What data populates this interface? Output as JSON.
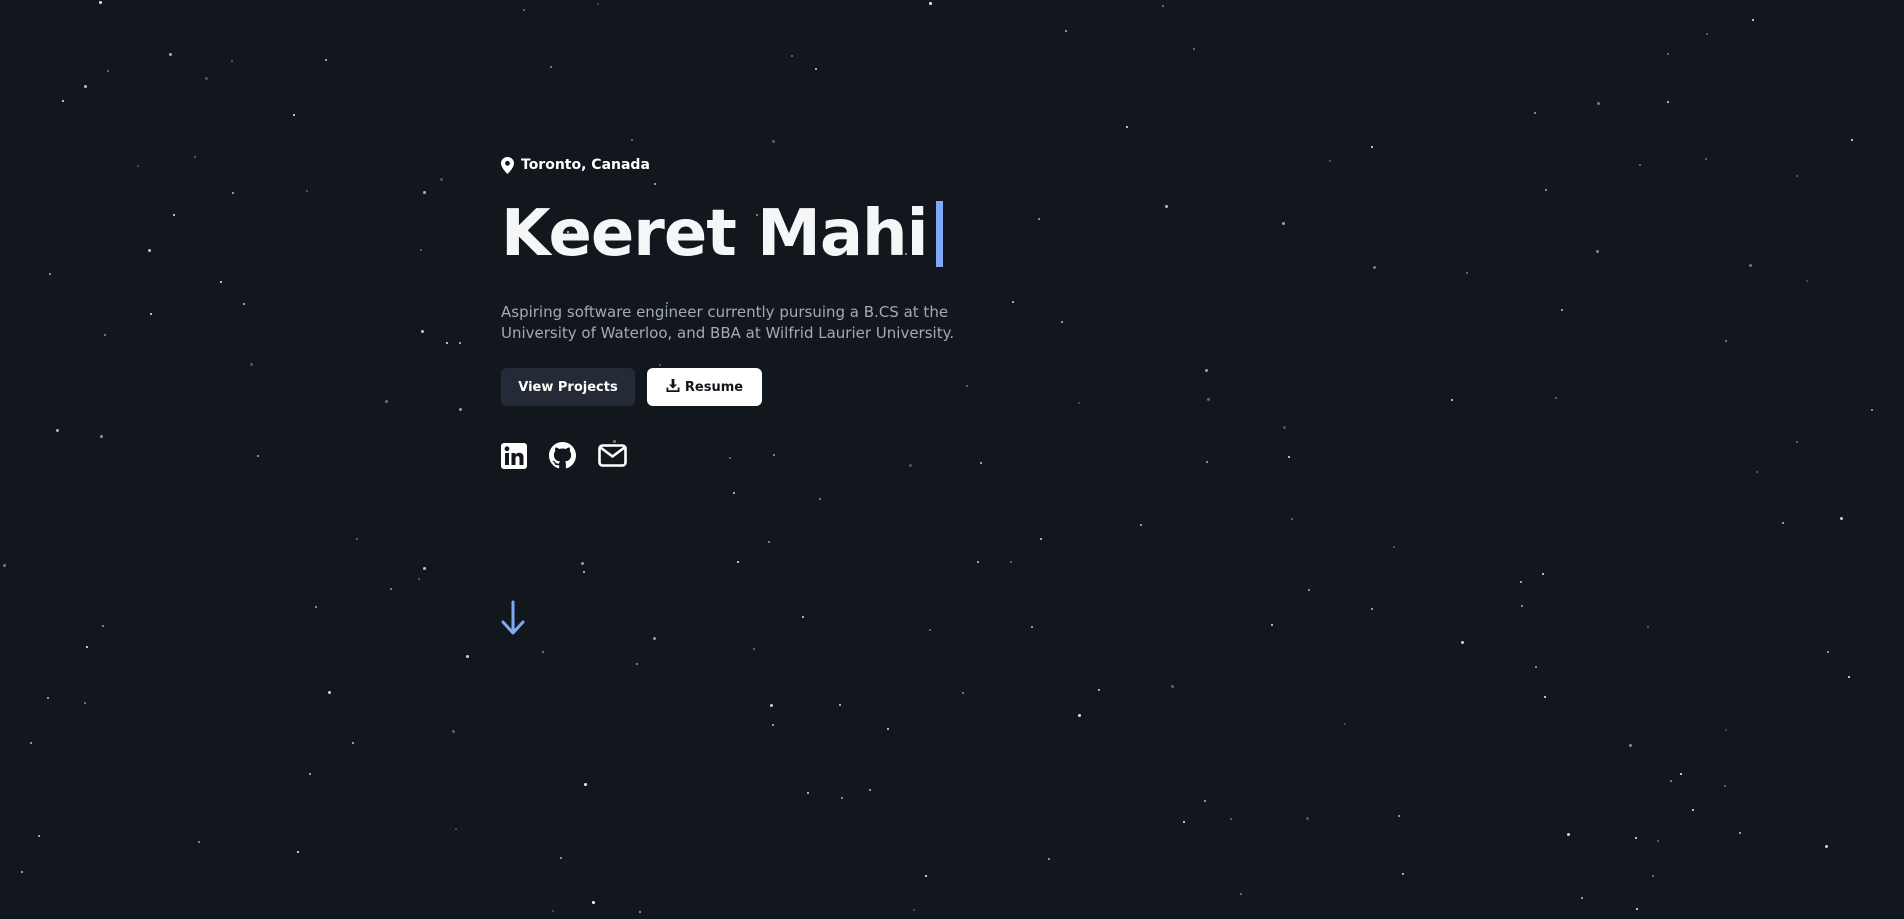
{
  "hero": {
    "location": "Toronto, Canada",
    "name": "Keeret Mahi",
    "bio": "Aspiring software engineer currently pursuing a B.CS at the University of Waterloo, and BBA at Wilfrid Laurier University.",
    "buttons": {
      "projects_label": "View Projects",
      "resume_label": "Resume"
    },
    "socials": [
      {
        "icon": "linkedin-icon"
      },
      {
        "icon": "github-icon"
      },
      {
        "icon": "mail-icon"
      }
    ]
  },
  "scroll": {
    "icon": "arrow-down-icon"
  },
  "colors": {
    "background": "#12171e",
    "accent": "#7fa8f5",
    "secondary_button": "#242b36",
    "body_text": "#a3aab5"
  }
}
